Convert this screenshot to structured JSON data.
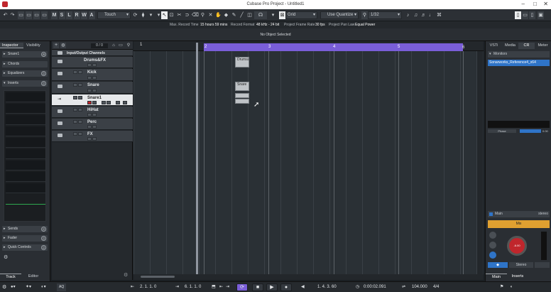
{
  "app": {
    "title": "Cubase Pro Project - Untitled1"
  },
  "colors": {
    "accent": "#7a5ed8",
    "selection_blue": "#2f74c8",
    "track_grey": "#3b4046",
    "selected_track": "#e6e8ea",
    "mix_orange": "#e0a030",
    "knob_red": "#c0262c"
  },
  "toolbar": {
    "mode_letters": [
      "M",
      "S",
      "L",
      "R",
      "W",
      "A"
    ],
    "automation_mode": "Touch",
    "snap_type": "Grid",
    "quantize_preset": "Use Quantize",
    "quantize_value": "1/32"
  },
  "infoline": {
    "max_record_time_label": "Max. Record Time",
    "max_record_time_value": "15 hours 59 mins",
    "record_format_label": "Record Format",
    "record_format_value": "48 kHz - 24 bit",
    "frame_rate_label": "Project Frame Rate",
    "frame_rate_value": "30 fps",
    "pan_law_label": "Project Pan Law",
    "pan_law_value": "Equal Power"
  },
  "status": {
    "message": "No Object Selected"
  },
  "inspector": {
    "tabs": [
      "Inspector",
      "Visibility"
    ],
    "track_name": "Snare1",
    "sections": [
      "Chords",
      "Equalizers",
      "Inserts",
      "Sends",
      "Fader",
      "Quick Controls"
    ],
    "bottom_tabs": [
      "Track",
      "Editor"
    ]
  },
  "tracklist": {
    "counter": "0 / 0",
    "tracks": [
      {
        "name": "Input/Output Channels",
        "kind": "folder"
      },
      {
        "name": "Drums&FX",
        "kind": "folder"
      },
      {
        "name": "Kick",
        "kind": "audio"
      },
      {
        "name": "Snare",
        "kind": "audio"
      },
      {
        "name": "Snare1",
        "kind": "audio",
        "selected": true
      },
      {
        "name": "HiHat",
        "kind": "audio"
      },
      {
        "name": "Perc",
        "kind": "audio"
      },
      {
        "name": "FX",
        "kind": "audio"
      }
    ]
  },
  "ruler": {
    "bars": [
      "1",
      "2",
      "3",
      "4",
      "5",
      "6"
    ]
  },
  "events": [
    {
      "label": "Drums&F"
    },
    {
      "label": "Snare"
    },
    {
      "label": ""
    },
    {
      "label": ""
    }
  ],
  "rightzone": {
    "tabs": [
      "VSTi",
      "Media",
      "CR",
      "Meter"
    ],
    "monitors_label": "Monitors",
    "monitor_item": "Sonarworks_Reference4_x64",
    "phase_label": "Phase",
    "phase_value": "0.00",
    "main_label": "Main",
    "main_value": "stereo",
    "mix_label": "Mix",
    "knob_value": "-6.00",
    "stereo_label": "Stereo",
    "bottom_tabs": [
      "Main",
      "Inserts"
    ]
  },
  "transport": {
    "left_locator": "2. 1. 1. 0",
    "right_locator": "6. 1. 1. 0",
    "position_bars": "1. 4. 3. 60",
    "position_time": "0:00:02.091",
    "tempo": "104.000",
    "signature": "4/4"
  }
}
